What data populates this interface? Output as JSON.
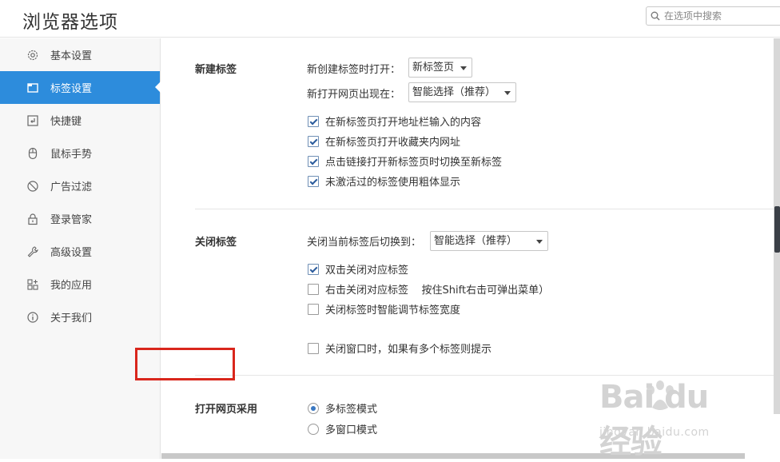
{
  "header": {
    "title": "浏览器选项",
    "search_placeholder": "在选项中搜索"
  },
  "sidebar": {
    "items": [
      {
        "label": "基本设置",
        "icon": "gear-icon",
        "active": false
      },
      {
        "label": "标签设置",
        "icon": "tab-icon",
        "active": true
      },
      {
        "label": "快捷键",
        "icon": "shortcut-key-icon",
        "active": false
      },
      {
        "label": "鼠标手势",
        "icon": "mouse-icon",
        "active": false
      },
      {
        "label": "广告过滤",
        "icon": "block-icon",
        "active": false
      },
      {
        "label": "登录管家",
        "icon": "lock-icon",
        "active": false
      },
      {
        "label": "高级设置",
        "icon": "wrench-icon",
        "active": false
      },
      {
        "label": "我的应用",
        "icon": "apps-icon",
        "active": false
      },
      {
        "label": "关于我们",
        "icon": "info-icon",
        "active": false
      }
    ]
  },
  "new_tab": {
    "title": "新建标签",
    "open_label": "新创建标签时打开：",
    "open_value": "新标签页",
    "position_label": "新打开网页出现在：",
    "position_value": "智能选择（推荐）",
    "options": [
      {
        "label": "在新标签页打开地址栏输入的内容",
        "checked": true
      },
      {
        "label": "在新标签页打开收藏夹内网址",
        "checked": true
      },
      {
        "label": "点击链接打开新标签页时切换至新标签",
        "checked": true
      },
      {
        "label": "未激活过的标签使用粗体显示",
        "checked": true
      }
    ]
  },
  "close_tab": {
    "title": "关闭标签",
    "switch_label": "关闭当前标签后切换到：",
    "switch_value": "智能选择（推荐）",
    "options": [
      {
        "label": "双击关闭对应标签",
        "checked": true
      },
      {
        "label": "右击关闭对应标签    按住Shift右击可弹出菜单）",
        "checked": false
      },
      {
        "label": "关闭标签时智能调节标签宽度",
        "checked": false
      },
      {
        "label": "关闭窗口时，如果有多个标签则提示",
        "checked": false
      }
    ]
  },
  "open_mode": {
    "title": "打开网页采用",
    "options": [
      {
        "label": "多标签模式",
        "checked": true
      },
      {
        "label": "多窗口模式",
        "checked": false
      }
    ]
  },
  "watermark": {
    "logo": "Bai du 经验",
    "url": "jingyan.baidu.com"
  },
  "colors": {
    "accent": "#2d8cdc",
    "highlight": "#d9261c"
  }
}
